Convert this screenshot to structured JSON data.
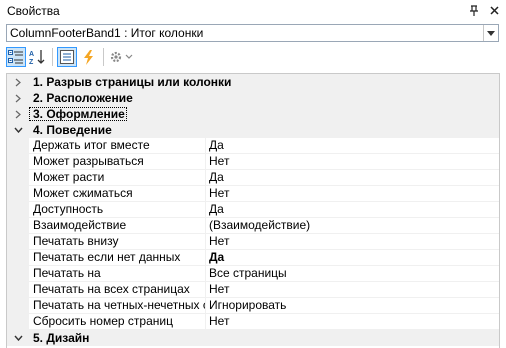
{
  "panel": {
    "title": "Свойства",
    "pin_icon": "pin-icon",
    "close_icon": "close-icon"
  },
  "selector": {
    "value": "ColumnFooterBand1 : Итог колонки"
  },
  "toolbar": {
    "buttons": [
      "categorized-icon",
      "alphabetical-icon",
      "properties-icon",
      "events-icon",
      "settings-icon"
    ]
  },
  "grid": {
    "categories": [
      {
        "label": "1. Разрыв страницы или колонки",
        "expanded": false
      },
      {
        "label": "2. Расположение",
        "expanded": false
      },
      {
        "label": "3. Оформление",
        "expanded": false
      },
      {
        "label": "4. Поведение",
        "expanded": true
      },
      {
        "label": "5. Дизайн",
        "expanded": true
      }
    ],
    "behavior_props": [
      {
        "name": "Держать итог вместе",
        "value": "Да"
      },
      {
        "name": "Может разрываться",
        "value": "Нет"
      },
      {
        "name": "Может расти",
        "value": "Да"
      },
      {
        "name": "Может сжиматься",
        "value": "Нет"
      },
      {
        "name": "Доступность",
        "value": "Да"
      },
      {
        "name": "Взаимодействие",
        "value": "(Взаимодействие)"
      },
      {
        "name": "Печатать внизу",
        "value": "Нет"
      },
      {
        "name": "Печатать если нет данных",
        "value": "Да"
      },
      {
        "name": "Печатать на",
        "value": "Все страницы"
      },
      {
        "name": "Печатать на всех страницах",
        "value": "Нет"
      },
      {
        "name": "Печатать на четных-нечетных с",
        "value": "Игнорировать"
      },
      {
        "name": "Сбросить номер страниц",
        "value": "Нет"
      }
    ]
  }
}
